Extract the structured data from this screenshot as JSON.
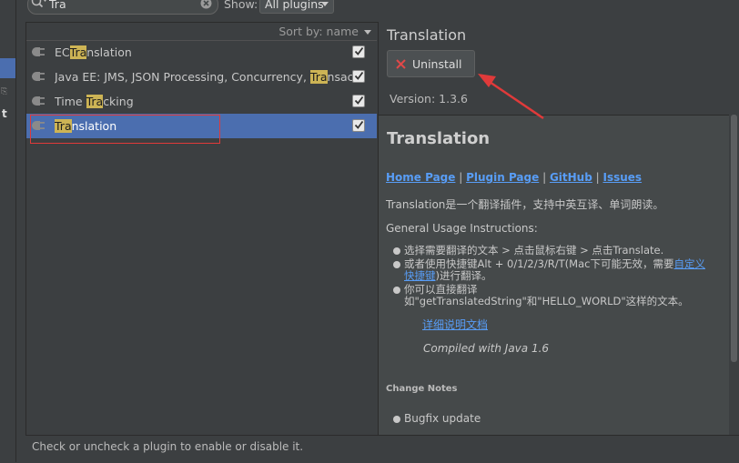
{
  "colors": {
    "selection": "#4b6eaf",
    "highlight": "#cdb455",
    "link": "#589df6",
    "annotation": "#e03a3a"
  },
  "search": {
    "value": "Tra",
    "icon": "search-icon",
    "clear_icon": "clear-icon"
  },
  "filter": {
    "show_label": "Show:",
    "selected": "All plugins"
  },
  "list": {
    "sort_label": "Sort by: name",
    "plugins": [
      {
        "pre": "EC",
        "match": "Tra",
        "post": "nslation",
        "enabled": true,
        "selected": false
      },
      {
        "pre": "Java EE: JMS, JSON Processing, Concurrency, ",
        "match": "Tra",
        "post": "nsac",
        "enabled": true,
        "selected": false
      },
      {
        "pre": "Time ",
        "match": "Tra",
        "post": "cking",
        "enabled": true,
        "selected": false
      },
      {
        "pre": "",
        "match": "Tra",
        "post": "nslation",
        "enabled": true,
        "selected": true
      }
    ]
  },
  "detail": {
    "title": "Translation",
    "uninstall_label": "Uninstall",
    "version": "Version: 1.3.6",
    "heading": "Translation",
    "links": {
      "home": "Home Page",
      "plugin": "Plugin Page",
      "github": "GitHub",
      "issues": "Issues",
      "sep": " | "
    },
    "description": "Translation是一个翻译插件，支持中英互译、单词朗读。",
    "usage_title": "General Usage Instructions:",
    "usage": {
      "item1": "选择需要翻译的文本 > 点击鼠标右键 > 点击Translate.",
      "item2_pre": "或者使用快捷键Alt + 0/1/2/3/R/T(Mac下可能无效，需要",
      "item2_link": "自定义快捷键",
      "item2_post": ")进行翻译。",
      "item3": "你可以直接翻译如\"getTranslatedString\"和\"HELLO_WORLD\"这样的文本。"
    },
    "doc_link": "详细说明文档",
    "compiled": "Compiled with Java 1.6",
    "change_notes_title": "Change Notes",
    "change_notes": [
      "Bugfix update"
    ]
  },
  "status": "Check or uncheck a plugin to enable or disable it."
}
